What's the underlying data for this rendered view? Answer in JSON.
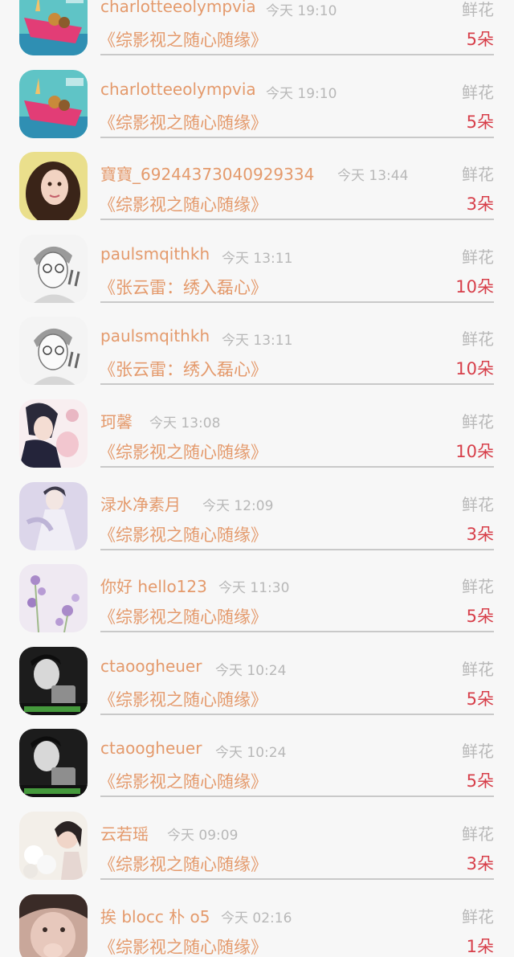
{
  "records": [
    {
      "name": "charlotteeolympvia",
      "time": "今天 19:10",
      "gift": "鲜花",
      "book": "《综影视之随心随缘》",
      "count": "5朵",
      "avatar": "pink-boat-icon"
    },
    {
      "name": "charlotteeolympvia",
      "time": "今天 19:10",
      "gift": "鲜花",
      "book": "《综影视之随心随缘》",
      "count": "5朵",
      "avatar": "pink-boat-icon"
    },
    {
      "name": "寶寶_69244373040929334",
      "time": "今天 13:44",
      "gift": "鲜花",
      "book": "《综影视之随心随缘》",
      "count": "3朵",
      "avatar": "woman-portrait-icon"
    },
    {
      "name": "paulsmqithkh",
      "time": "今天 13:11",
      "gift": "鲜花",
      "book": "《张云雷：绣入磊心》",
      "count": "10朵",
      "avatar": "sketch-boy-icon"
    },
    {
      "name": "paulsmqithkh",
      "time": "今天 13:11",
      "gift": "鲜花",
      "book": "《张云雷：绣入磊心》",
      "count": "10朵",
      "avatar": "sketch-boy-icon"
    },
    {
      "name": "珂馨",
      "time": "今天 13:08",
      "gift": "鲜花",
      "book": "《综影视之随心随缘》",
      "count": "10朵",
      "avatar": "anime-couple-icon"
    },
    {
      "name": "渌水净素月",
      "time": "今天 12:09",
      "gift": "鲜花",
      "book": "《综影视之随心随缘》",
      "count": "3朵",
      "avatar": "ancient-figure-icon"
    },
    {
      "name": "你好 hello123",
      "time": "今天 11:30",
      "gift": "鲜花",
      "book": "《综影视之随心随缘》",
      "count": "5朵",
      "avatar": "lavender-icon"
    },
    {
      "name": "ctaoogheuer",
      "time": "今天 10:24",
      "gift": "鲜花",
      "book": "《综影视之随心随缘》",
      "count": "5朵",
      "avatar": "bw-photo-icon"
    },
    {
      "name": "ctaoogheuer",
      "time": "今天 10:24",
      "gift": "鲜花",
      "book": "《综影视之随心随缘》",
      "count": "5朵",
      "avatar": "bw-photo-icon"
    },
    {
      "name": "云若瑶",
      "time": "今天 09:09",
      "gift": "鲜花",
      "book": "《综影视之随心随缘》",
      "count": "3朵",
      "avatar": "flowers-woman-icon"
    },
    {
      "name": "挨 blocc 朴 o5",
      "time": "今天 02:16",
      "gift": "鲜花",
      "book": "《综影视之随心随缘》",
      "count": "1朵",
      "avatar": "selfie-icon"
    }
  ]
}
